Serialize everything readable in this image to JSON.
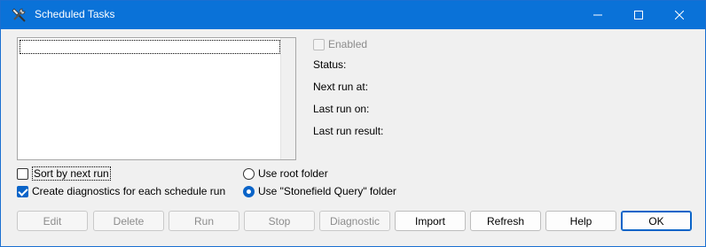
{
  "window": {
    "title": "Scheduled Tasks"
  },
  "options": {
    "sort_label": "Sort by next run",
    "sort_checked": false,
    "diagnostics_label": "Create diagnostics for each schedule run",
    "diagnostics_checked": true,
    "root_folder_label": "Use root folder",
    "query_folder_label": "Use \"Stonefield Query\" folder",
    "selected_folder": "query"
  },
  "details": {
    "enabled_label": "Enabled",
    "status_label": "Status:",
    "next_run_label": "Next run at:",
    "last_run_label": "Last run on:",
    "last_result_label": "Last run result:"
  },
  "buttons": {
    "edit": "Edit",
    "delete": "Delete",
    "run": "Run",
    "stop": "Stop",
    "diagnostic": "Diagnostic",
    "import": "Import",
    "refresh": "Refresh",
    "help": "Help",
    "ok": "OK"
  },
  "colors": {
    "titlebar": "#0a72d8",
    "accent": "#0a64c8"
  }
}
